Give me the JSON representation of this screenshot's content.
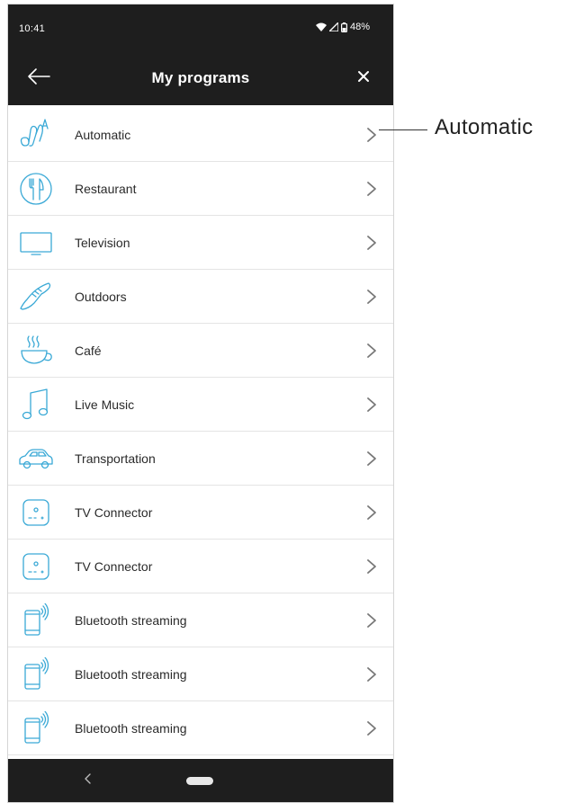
{
  "status_bar": {
    "time": "10:41",
    "battery": "48%"
  },
  "app_bar": {
    "title": "My programs",
    "back_icon": "arrow-left-icon",
    "close_icon": "close-icon"
  },
  "programs": [
    {
      "label": "Automatic",
      "icon": "automatic-ear-icon"
    },
    {
      "label": "Restaurant",
      "icon": "fork-knife-icon"
    },
    {
      "label": "Television",
      "icon": "television-icon"
    },
    {
      "label": "Outdoors",
      "icon": "sneaker-icon"
    },
    {
      "label": "Café",
      "icon": "coffee-cup-icon"
    },
    {
      "label": "Live Music",
      "icon": "music-note-icon"
    },
    {
      "label": "Transportation",
      "icon": "car-icon"
    },
    {
      "label": "TV Connector",
      "icon": "tv-connector-icon"
    },
    {
      "label": "TV Connector",
      "icon": "tv-connector-icon"
    },
    {
      "label": "Bluetooth streaming",
      "icon": "phone-streaming-icon"
    },
    {
      "label": "Bluetooth streaming",
      "icon": "phone-streaming-icon"
    },
    {
      "label": "Bluetooth streaming",
      "icon": "phone-streaming-icon"
    }
  ],
  "callout": {
    "label": "Automatic"
  },
  "colors": {
    "bar_background": "#1e1e1e",
    "icon_stroke": "#3aa9d6",
    "divider": "#e4e4e4",
    "chevron": "#777777"
  }
}
